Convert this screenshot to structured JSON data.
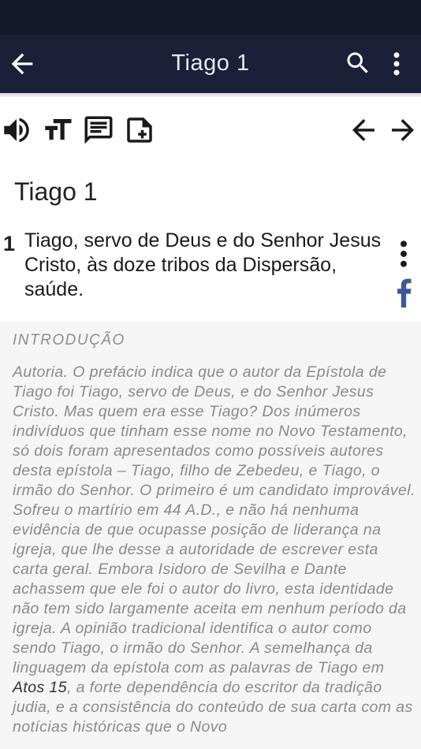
{
  "header": {
    "title": "Tiago 1",
    "back_icon": "arrow-left-icon",
    "search_icon": "search-icon",
    "more_icon": "more-vert-icon"
  },
  "toolbar": {
    "icons": [
      "volume-icon",
      "text-size-icon",
      "comment-icon",
      "add-note-icon",
      "prev-arrow-icon",
      "next-arrow-icon"
    ]
  },
  "chapter": {
    "title": "Tiago 1",
    "verse_number": "1",
    "verse_text": "Tiago, servo de Deus e do Senhor Jesus Cristo, às doze tribos da Dispersão, saúde."
  },
  "intro": {
    "heading": "INTRODUÇÃO",
    "body_part1": "Autoria. O prefácio indica que o autor da Epístola de Tiago foi Tiago, servo de Deus, e do Senhor Jesus Cristo. Mas quem era esse Tiago? Dos inúmeros indivíduos que tinham esse nome no Novo Testamento, só dois foram apresentados como possíveis autores desta epístola – Tiago, filho de Zebedeu, e Tiago, o irmão do Senhor. O primeiro é um candidato improvável. Sofreu o martírio em 44 A.D., e não há nenhuma evidência de que ocupasse posição de liderança na igreja, que lhe desse a autoridade de escrever esta carta geral. Embora Isidoro de Sevilha e Dante achassem que ele foi o autor do livro, esta identidade não tem sido largamente aceita em nenhum período da igreja. A opinião tradicional identifica o autor como sendo Tiago, o irmão do Senhor. A semelhança da linguagem da epístola com as palavras de Tiago em ",
    "reference": "Atos 15",
    "body_part2": ", a forte dependência do escritor da tradição judia, e a consistência do conteúdo de sua carta com as notícias históricas que o Novo"
  },
  "colors": {
    "status_bar": "#15172a",
    "app_bar": "#1c1f38",
    "facebook": "#3b5998",
    "intro_bg": "#f5f5f5"
  }
}
